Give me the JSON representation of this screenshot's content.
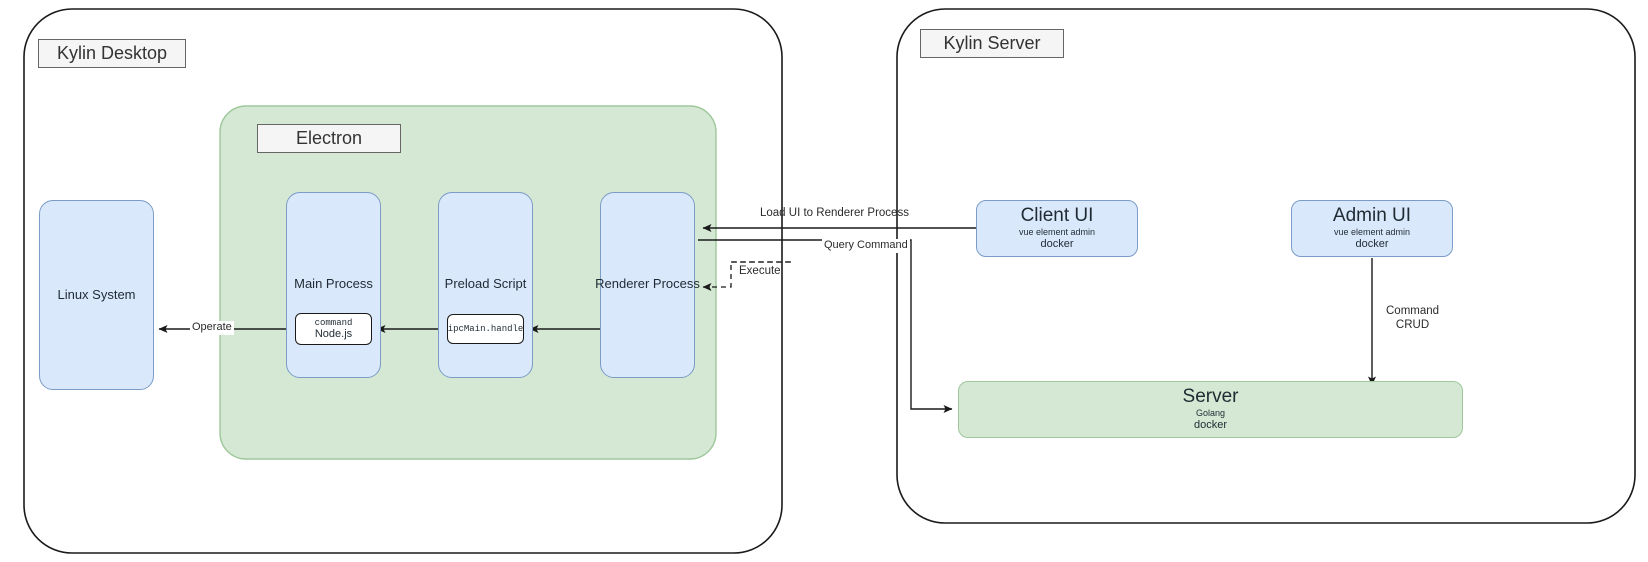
{
  "diagram": {
    "title_not_shown": "",
    "colors": {
      "blue_fill": "#dae8fc",
      "blue_stroke": "#7b9cc6",
      "green_fill": "#d5e8d4",
      "green_stroke": "#9ec79b",
      "panel_stroke": "#1a1a1a",
      "label_fill": "#f5f5f5",
      "label_stroke": "#666666",
      "line": "#1a1a1a",
      "text": "#2b2b2b"
    },
    "panels": [
      {
        "id": "kylin-desktop",
        "label": "Kylin Desktop"
      },
      {
        "id": "kylin-server",
        "label": "Kylin Server"
      }
    ],
    "groups": [
      {
        "id": "electron",
        "label": "Electron"
      }
    ],
    "nodes": [
      {
        "id": "linux-system",
        "label": "Linux System"
      },
      {
        "id": "main-process",
        "label": "Main Process"
      },
      {
        "id": "preload-script",
        "label": "Preload Script"
      },
      {
        "id": "renderer-process",
        "label": "Renderer Process"
      },
      {
        "id": "command-nodejs",
        "line1": "command",
        "line2": "Node.js"
      },
      {
        "id": "ipcmain-handle",
        "label": "ipcMain.handle"
      },
      {
        "id": "client-ui",
        "title": "Client UI",
        "sub1": "vue element admin",
        "sub2": "docker"
      },
      {
        "id": "admin-ui",
        "title": "Admin UI",
        "sub1": "vue element admin",
        "sub2": "docker"
      },
      {
        "id": "server",
        "title": "Server",
        "sub1": "Golang",
        "sub2": "docker"
      }
    ],
    "edges": [
      {
        "id": "operate",
        "label": "Operate",
        "from": "command-nodejs",
        "to": "linux-system"
      },
      {
        "id": "ipc-to-main",
        "label": "",
        "from": "ipcmain-handle",
        "to": "command-nodejs"
      },
      {
        "id": "renderer-to-ipc",
        "label": "",
        "from": "renderer-process",
        "to": "ipcmain-handle"
      },
      {
        "id": "load-ui",
        "label": "Load UI to Renderer Process",
        "from": "client-ui",
        "to": "renderer-process"
      },
      {
        "id": "query-command",
        "label": "Query Command",
        "from": "renderer-process",
        "to": "server"
      },
      {
        "id": "execute",
        "label": "Execute",
        "from": "server",
        "to": "renderer-process",
        "style": "dashed"
      },
      {
        "id": "command-crud",
        "label1": "Command",
        "label2": "CRUD",
        "from": "admin-ui",
        "to": "server"
      }
    ]
  }
}
